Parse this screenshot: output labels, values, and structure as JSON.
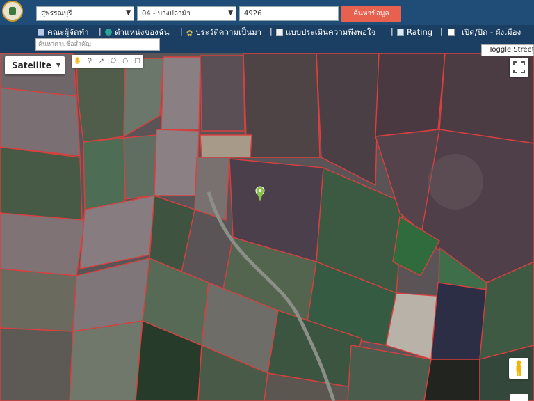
{
  "header": {
    "province_select": "สุพรรณบุรี",
    "district_select": "04 - บางปลาม้า",
    "parcel_input": "4926",
    "search_button": "ค้นหาข้อมูล"
  },
  "menu": {
    "items": [
      {
        "label": "คณะผู้จัดทำ",
        "icon": "book-icon"
      },
      {
        "label": "ตำแหน่งของฉัน",
        "icon": "globe-icon"
      },
      {
        "label": "ประวัติความเป็นมา",
        "icon": "sprout-icon"
      },
      {
        "label": "แบบประเมินความพึงพอใจ",
        "icon": "document-icon"
      },
      {
        "label": "Rating",
        "icon": "chart-icon"
      },
      {
        "label": "เปิด/ปิด - ผังเมือง",
        "icon": "checkbox-icon"
      }
    ],
    "filter_placeholder": "ค้นหาตามชื่อสำคัญ"
  },
  "map": {
    "map_type": "Satellite",
    "toggle_street_view": "Toggle Street V",
    "marker_color": "#8bc34a",
    "parcel_line_color": "#e23b3b"
  }
}
